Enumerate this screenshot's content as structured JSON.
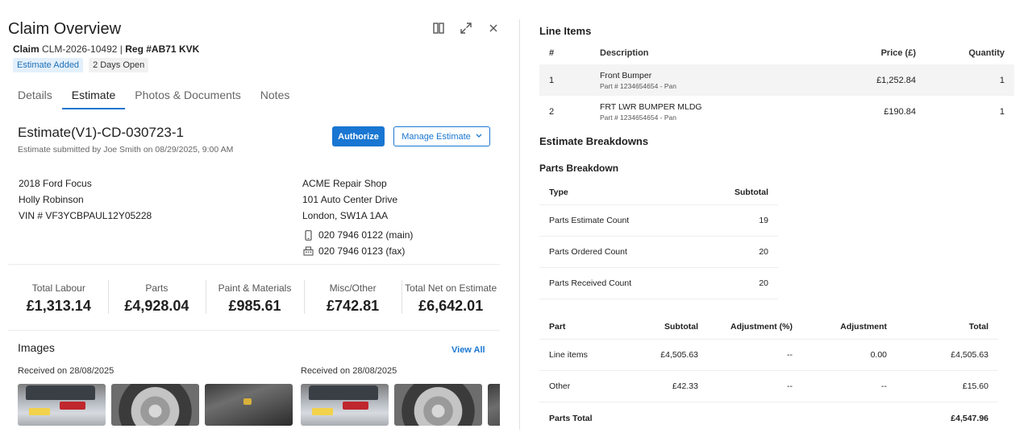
{
  "header": {
    "title": "Claim Overview",
    "claim_label": "Claim",
    "claim_number": "CLM-2026-10492",
    "separator": "|",
    "reg_label": "Reg #AB71 KVK",
    "badges": [
      "Estimate Added",
      "2 Days Open"
    ],
    "icons": [
      "columns-icon",
      "expand-icon",
      "close-icon"
    ]
  },
  "tabs": [
    {
      "label": "Details",
      "active": false
    },
    {
      "label": "Estimate",
      "active": true
    },
    {
      "label": "Photos & Documents",
      "active": false
    },
    {
      "label": "Notes",
      "active": false
    }
  ],
  "estimate": {
    "title": "Estimate(V1)-CD-030723-1",
    "subtitle": "Estimate submitted by Joe Smith on 08/29/2025, 9:00 AM",
    "authorize_label": "Authorize",
    "manage_label": "Manage Estimate"
  },
  "vehicle": {
    "model": "2018 Ford Focus",
    "owner": "Holly Robinson",
    "vin": "VIN # VF3YCBPAUL12Y05228"
  },
  "shop": {
    "name": "ACME Repair Shop",
    "address1": "101 Auto Center Drive",
    "address2": "London, SW1A 1AA",
    "phone_main": "020 7946 0122 (main)",
    "phone_fax": "020 7946 0123 (fax)"
  },
  "totals": [
    {
      "label": "Total Labour",
      "value": "£1,313.14"
    },
    {
      "label": "Parts",
      "value": "£4,928.04"
    },
    {
      "label": "Paint & Materials",
      "value": "£985.61"
    },
    {
      "label": "Misc/Other",
      "value": "£742.81"
    },
    {
      "label": "Total Net on Estimate",
      "value": "£6,642.01"
    }
  ],
  "images": {
    "title": "Images",
    "view_all": "View All",
    "groups": [
      {
        "received": "Received on 28/08/2025"
      },
      {
        "received": "Received on 28/08/2025"
      }
    ]
  },
  "line_items": {
    "title": "Line Items",
    "headers": [
      "#",
      "Description",
      "Price (£)",
      "Quantity"
    ],
    "rows": [
      {
        "num": "1",
        "desc": "Front Bumper",
        "part": "Part # 1234654654 - Pan",
        "price": "£1,252.84",
        "qty": "1"
      },
      {
        "num": "2",
        "desc": "FRT LWR BUMPER MLDG",
        "part": "Part # 1234654654 - Pan",
        "price": "£190.84",
        "qty": "1"
      }
    ]
  },
  "breakdowns": {
    "title": "Estimate Breakdowns",
    "parts_title": "Parts Breakdown",
    "parts_headers": [
      "Type",
      "Subtotal"
    ],
    "parts_rows": [
      {
        "type": "Parts Estimate Count",
        "subtotal": "19"
      },
      {
        "type": "Parts Ordered Count",
        "subtotal": "20"
      },
      {
        "type": "Parts Received Count",
        "subtotal": "20"
      }
    ],
    "table_headers": [
      "Part",
      "Subtotal",
      "Adjustment (%)",
      "Adjustment",
      "Total"
    ],
    "table_rows": [
      {
        "part": "Line items",
        "subtotal": "£4,505.63",
        "adj_pct": "--",
        "adj": "0.00",
        "total": "£4,505.63"
      },
      {
        "part": "Other",
        "subtotal": "£42.33",
        "adj_pct": "--",
        "adj": "--",
        "total": "£15.60"
      }
    ],
    "footer": {
      "part": "Parts Total",
      "total": "£4,547.96"
    }
  },
  "colors": {
    "accent": "#1976d2",
    "badge_blue_bg": "#e3f0fb",
    "row_shade": "#f4f4f4"
  }
}
